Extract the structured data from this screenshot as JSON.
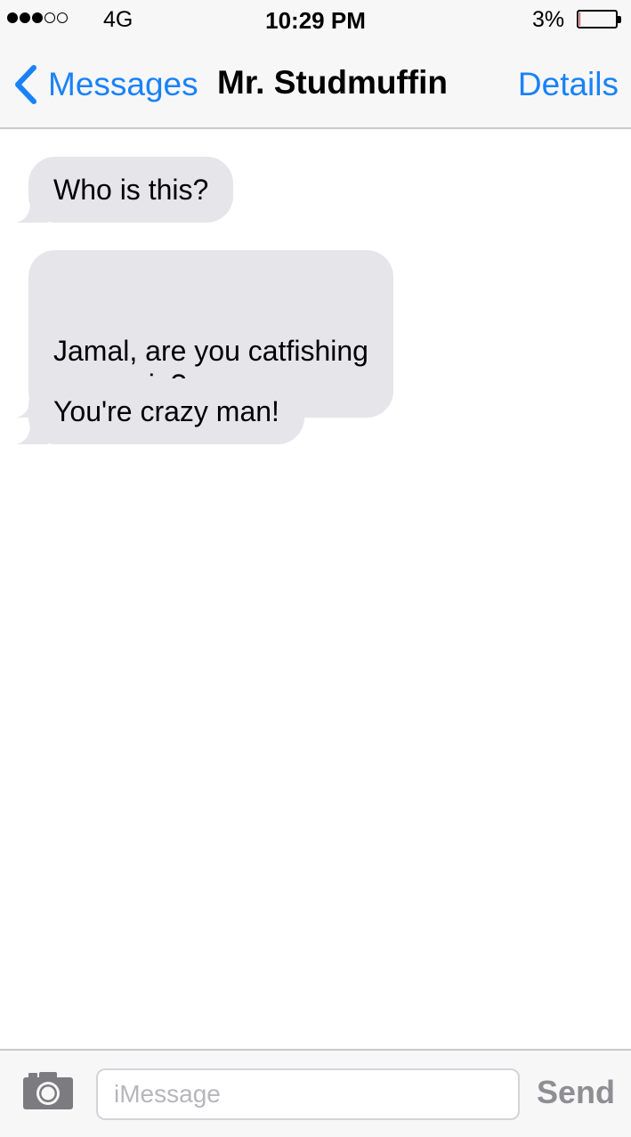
{
  "status_bar": {
    "signal_bars_filled": 3,
    "signal_bars_total": 5,
    "network": "4G",
    "time": "10:29 PM",
    "battery_percent_label": "3%",
    "battery_level": 0.03,
    "battery_color": "#e0262c"
  },
  "nav": {
    "back_label": "Messages",
    "title": "Mr. Studmuffin",
    "details_label": "Details",
    "accent_color": "#1a82f7"
  },
  "messages": [
    {
      "direction": "incoming",
      "text": "Who is this?"
    },
    {
      "direction": "incoming",
      "text": "Jamal, are you catfishing\nme again?"
    },
    {
      "direction": "incoming",
      "text": "You're crazy man!"
    }
  ],
  "composer": {
    "camera_icon": "camera-icon",
    "placeholder": "iMessage",
    "value": "",
    "send_label": "Send"
  }
}
